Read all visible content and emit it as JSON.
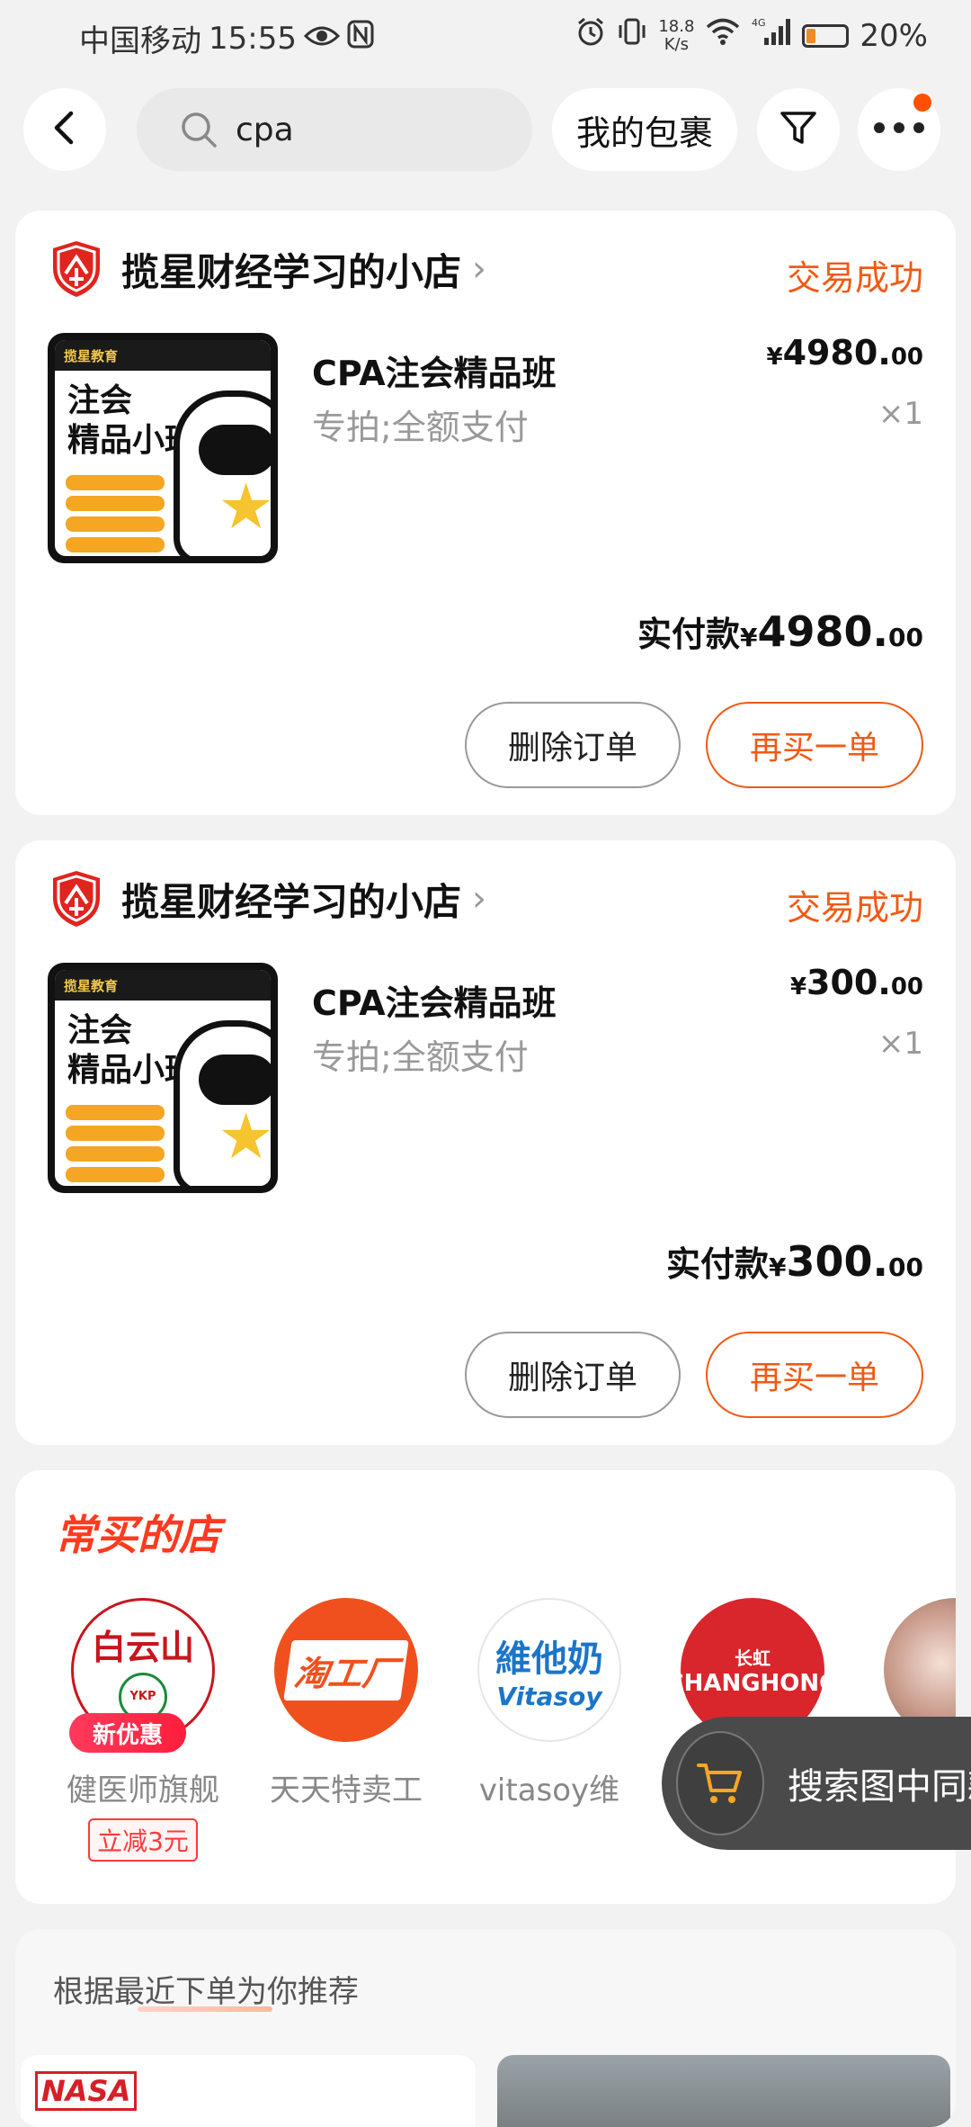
{
  "status_bar": {
    "carrier": "中国移动",
    "time": "15:55",
    "net_speed_value": "18.8",
    "net_speed_unit": "K/s",
    "battery_level": 0.2,
    "battery_text": "20%",
    "signal_type": "4G"
  },
  "top_bar": {
    "search_value": "cpa",
    "my_packages_label": "我的包裹",
    "icons": [
      "back-icon",
      "search-icon",
      "filter-icon",
      "more-icon"
    ]
  },
  "orders": [
    {
      "shop_name": "揽星财经学习的小店",
      "status": "交易成功",
      "thumb_brand": "揽星教育",
      "thumb_title_1": "注会",
      "thumb_title_2": "精品小班",
      "product_name": "CPA注会精品班",
      "sku": "专拍;全额支付",
      "price_symbol": "¥",
      "price_int": "4980.",
      "price_dec": "00",
      "quantity": "×1",
      "paid_label": "实付款",
      "paid_symbol": "¥",
      "paid_int": "4980.",
      "paid_dec": "00",
      "delete_label": "删除订单",
      "rebuy_label": "再买一单"
    },
    {
      "shop_name": "揽星财经学习的小店",
      "status": "交易成功",
      "thumb_brand": "揽星教育",
      "thumb_title_1": "注会",
      "thumb_title_2": "精品小班",
      "product_name": "CPA注会精品班",
      "sku": "专拍;全额支付",
      "price_symbol": "¥",
      "price_int": "300.",
      "price_dec": "00",
      "quantity": "×1",
      "paid_label": "实付款",
      "paid_symbol": "¥",
      "paid_int": "300.",
      "paid_dec": "00",
      "delete_label": "删除订单",
      "rebuy_label": "再买一单"
    }
  ],
  "frequent_shops": {
    "title": "常买的店",
    "items": [
      {
        "name": "健医师旗舰",
        "logo_text": "白云山",
        "logo_sub": "YKP",
        "badge": "新优惠",
        "discount": "立减3元"
      },
      {
        "name": "天天特卖工",
        "logo_text": "淘工厂"
      },
      {
        "name": "vitasoy维",
        "logo_text": "維他奶",
        "logo_sub": "Vitasoy"
      },
      {
        "name": "",
        "logo_text": "CHANGHONG",
        "logo_sub": "长虹"
      }
    ]
  },
  "floating_search": {
    "label": "搜索图中同款"
  },
  "recommend": {
    "title": "根据最近下单为你推荐",
    "card1_logo": "NASA"
  },
  "colors": {
    "accent": "#f05a14",
    "promo": "#ff3a1f",
    "badge": "#ff1e3c",
    "background": "#f2f2f2"
  }
}
